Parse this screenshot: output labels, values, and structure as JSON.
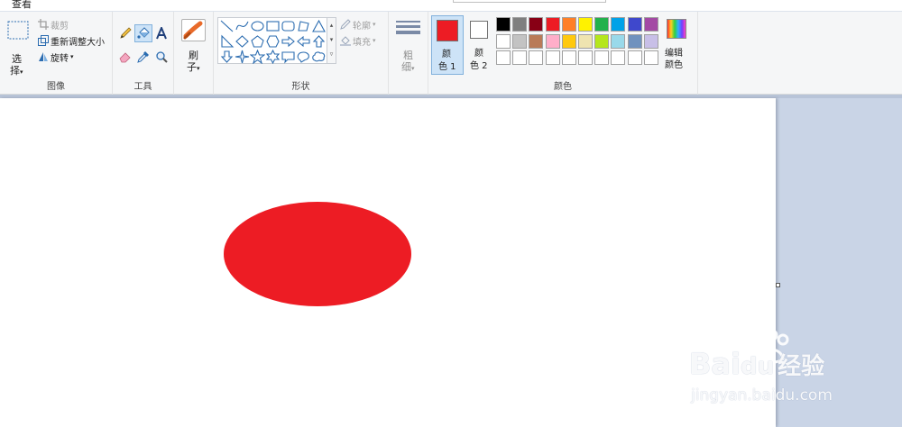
{
  "menu": {
    "view": "查看"
  },
  "image_group": {
    "label": "图像",
    "select_label_1": "选",
    "select_label_2": "择",
    "crop": "裁剪",
    "resize": "重新调整大小",
    "rotate": "旋转"
  },
  "tools_group": {
    "label": "工具"
  },
  "brush": {
    "label_1": "刷",
    "label_2": "子"
  },
  "shapes_group": {
    "label": "形状",
    "outline": "轮廓",
    "fill": "填充"
  },
  "size": {
    "label_1": "粗",
    "label_2": "细"
  },
  "color1": {
    "label_1": "颜",
    "label_2": "色 1",
    "color": "#ed1c24"
  },
  "color2": {
    "label_1": "颜",
    "label_2": "色 2",
    "color": "#ffffff"
  },
  "colors_group": {
    "label": "颜色",
    "palette_row1": [
      "#000000",
      "#7f7f7f",
      "#880015",
      "#ed1c24",
      "#ff7f27",
      "#fff200",
      "#22b14c",
      "#00a2e8",
      "#3f48cc",
      "#a349a4"
    ],
    "palette_row2": [
      "#ffffff",
      "#c3c3c3",
      "#b97a57",
      "#ffaec9",
      "#ffc90e",
      "#efe4b0",
      "#b5e61d",
      "#99d9ea",
      "#7092be",
      "#c8bfe7"
    ],
    "palette_row3": [
      "#ffffff",
      "#ffffff",
      "#ffffff",
      "#ffffff",
      "#ffffff",
      "#ffffff",
      "#ffffff",
      "#ffffff",
      "#ffffff",
      "#ffffff"
    ],
    "edit_1": "编辑",
    "edit_2": "颜色"
  },
  "canvas": {
    "shape": "ellipse",
    "fill": "#ed1c24"
  },
  "watermark": {
    "brand_1": "Bai",
    "brand_2": "du",
    "brand_3": "经验",
    "url": "jingyan.baidu.com"
  }
}
